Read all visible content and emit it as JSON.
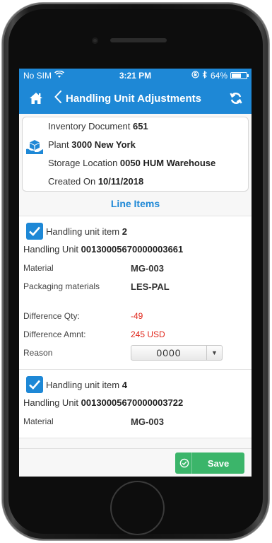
{
  "status_bar": {
    "carrier": "No SIM",
    "time": "3:21 PM",
    "battery": "64%",
    "battery_level": 0.64
  },
  "nav": {
    "title": "Handling Unit Adjustments"
  },
  "header": {
    "inventory_document_label": "Inventory Document",
    "inventory_document_value": "651",
    "plant_label": "Plant",
    "plant_value": "3000 New York",
    "storage_location_label": "Storage Location",
    "storage_location_value": "0050 HUM Warehouse",
    "created_on_label": "Created On",
    "created_on_value": "10/11/2018"
  },
  "section_title": "Line Items",
  "items": [
    {
      "title_label": "Handling unit item",
      "title_number": "2",
      "hu_label": "Handling Unit",
      "hu_value": "00130005670000003661",
      "material_label": "Material",
      "material_value": "MG-003",
      "packaging_label": "Packaging materials",
      "packaging_value": "LES-PAL",
      "diff_qty_label": "Difference Qty:",
      "diff_qty_value": "-49",
      "diff_amnt_label": "Difference Amnt:",
      "diff_amnt_value": "245 USD",
      "reason_label": "Reason",
      "reason_value": "0000"
    },
    {
      "title_label": "Handling unit item",
      "title_number": "4",
      "hu_label": "Handling Unit",
      "hu_value": "00130005670000003722",
      "material_label": "Material",
      "material_value": "MG-003"
    }
  ],
  "footer": {
    "save_label": "Save"
  },
  "colors": {
    "primary": "#1e88d6",
    "save_green": "#3bb56a",
    "negative_red": "#e0261a"
  }
}
